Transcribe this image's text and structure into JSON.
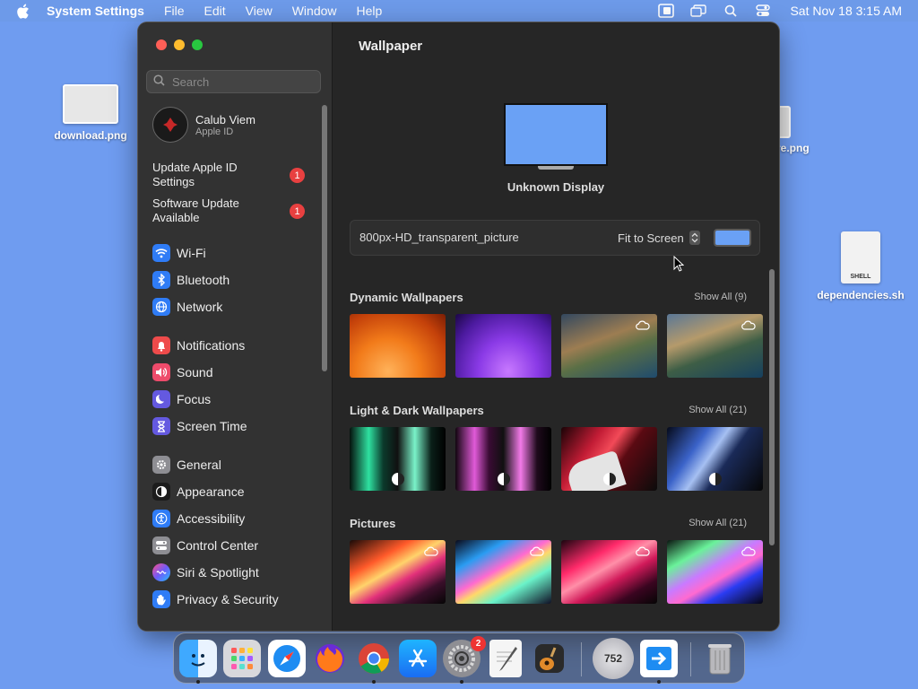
{
  "menubar": {
    "app_name": "System Settings",
    "menus": [
      "File",
      "Edit",
      "View",
      "Window",
      "Help"
    ],
    "clock": "Sat Nov 18  3:15 AM",
    "icons": [
      "stage-manager-icon",
      "screen-mirroring-icon",
      "spotlight-search-icon",
      "control-center-icon"
    ]
  },
  "desktop": {
    "icons": [
      {
        "label": "download.png"
      },
      {
        "label": "re.png"
      },
      {
        "label": "dependencies.sh",
        "tag": "SHELL"
      }
    ]
  },
  "sidebar": {
    "search_placeholder": "Search",
    "account": {
      "name": "Calub Viem",
      "subtitle": "Apple ID"
    },
    "notices": [
      {
        "label": "Update Apple ID Settings",
        "badge": "1"
      },
      {
        "label": "Software Update Available",
        "badge": "1"
      }
    ],
    "items": [
      {
        "label": "Wi-Fi",
        "icon": "wifi-icon",
        "color": "#2f7cf6"
      },
      {
        "label": "Bluetooth",
        "icon": "bluetooth-icon",
        "color": "#2f7cf6"
      },
      {
        "label": "Network",
        "icon": "globe-icon",
        "color": "#2f7cf6"
      },
      {
        "label": "Notifications",
        "icon": "bell-icon",
        "color": "#ee4b4b"
      },
      {
        "label": "Sound",
        "icon": "speaker-icon",
        "color": "#ee4b6b"
      },
      {
        "label": "Focus",
        "icon": "moon-icon",
        "color": "#6459e0"
      },
      {
        "label": "Screen Time",
        "icon": "hourglass-icon",
        "color": "#6459e0"
      },
      {
        "label": "General",
        "icon": "gear-icon",
        "color": "#8e8e93"
      },
      {
        "label": "Appearance",
        "icon": "appearance-icon",
        "color": "#1c1c1c"
      },
      {
        "label": "Accessibility",
        "icon": "accessibility-icon",
        "color": "#2f7cf6"
      },
      {
        "label": "Control Center",
        "icon": "control-center-icon",
        "color": "#8e8e93"
      },
      {
        "label": "Siri & Spotlight",
        "icon": "siri-icon",
        "color": "#b44ad8"
      },
      {
        "label": "Privacy & Security",
        "icon": "hand-icon",
        "color": "#2f7cf6"
      }
    ]
  },
  "content": {
    "title": "Wallpaper",
    "display_name": "Unknown Display",
    "wallpaper_name": "800px-HD_transparent_picture",
    "fit_mode": "Fit to Screen",
    "swatch_color": "#6aa1f5",
    "sections": [
      {
        "title": "Dynamic Wallpapers",
        "show_all": "Show All (9)"
      },
      {
        "title": "Light & Dark Wallpapers",
        "show_all": "Show All (21)"
      },
      {
        "title": "Pictures",
        "show_all": "Show All (21)"
      }
    ]
  },
  "dock": {
    "apps": [
      "Finder",
      "Launchpad",
      "Safari",
      "Firefox",
      "Chrome",
      "App Store",
      "System Settings",
      "TextEdit",
      "GarageBand",
      "752",
      "Migration",
      "Trash"
    ],
    "settings_badge": "2",
    "counter_label": "752"
  }
}
